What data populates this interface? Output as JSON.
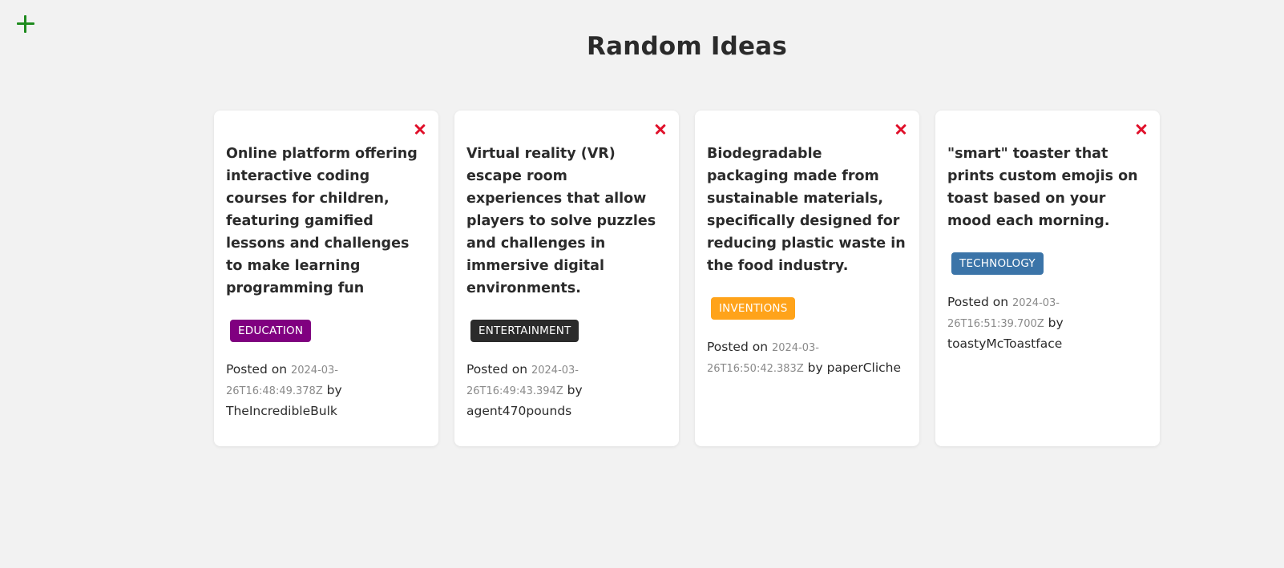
{
  "header": {
    "title": "Random Ideas"
  },
  "labels": {
    "posted_on": "Posted on",
    "by": "by"
  },
  "ideas": [
    {
      "text": "Online platform offering interactive coding courses for children, featuring gamified lessons and challenges to make learning programming fun",
      "tag": "EDUCATION",
      "tag_color": "#800080",
      "date": "2024-03-26T16:48:49.378Z",
      "username": "TheIncredibleBulk"
    },
    {
      "text": "Virtual reality (VR) escape room experiences that allow players to solve puzzles and challenges in immersive digital environments.",
      "tag": "ENTERTAINMENT",
      "tag_color": "#2b2b2b",
      "date": "2024-03-26T16:49:43.394Z",
      "username": "agent470pounds"
    },
    {
      "text": "Biodegradable packaging made from sustainable materials, specifically designed for reducing plastic waste in the food industry.",
      "tag": "INVENTIONS",
      "tag_color": "#ffa31a",
      "date": "2024-03-26T16:50:42.383Z",
      "username": "paperCliche"
    },
    {
      "text": "\"smart\" toaster that prints custom emojis on toast based on your mood each morning.",
      "tag": "TECHNOLOGY",
      "tag_color": "#3b74a8",
      "date": "2024-03-26T16:51:39.700Z",
      "username": "toastyMcToastface"
    }
  ],
  "colors": {
    "background": "#f2f2f2",
    "add_icon": "#1e8b1e",
    "delete_icon": "#e0112b"
  },
  "icons": {
    "add": "plus-icon",
    "delete": "close-icon"
  }
}
